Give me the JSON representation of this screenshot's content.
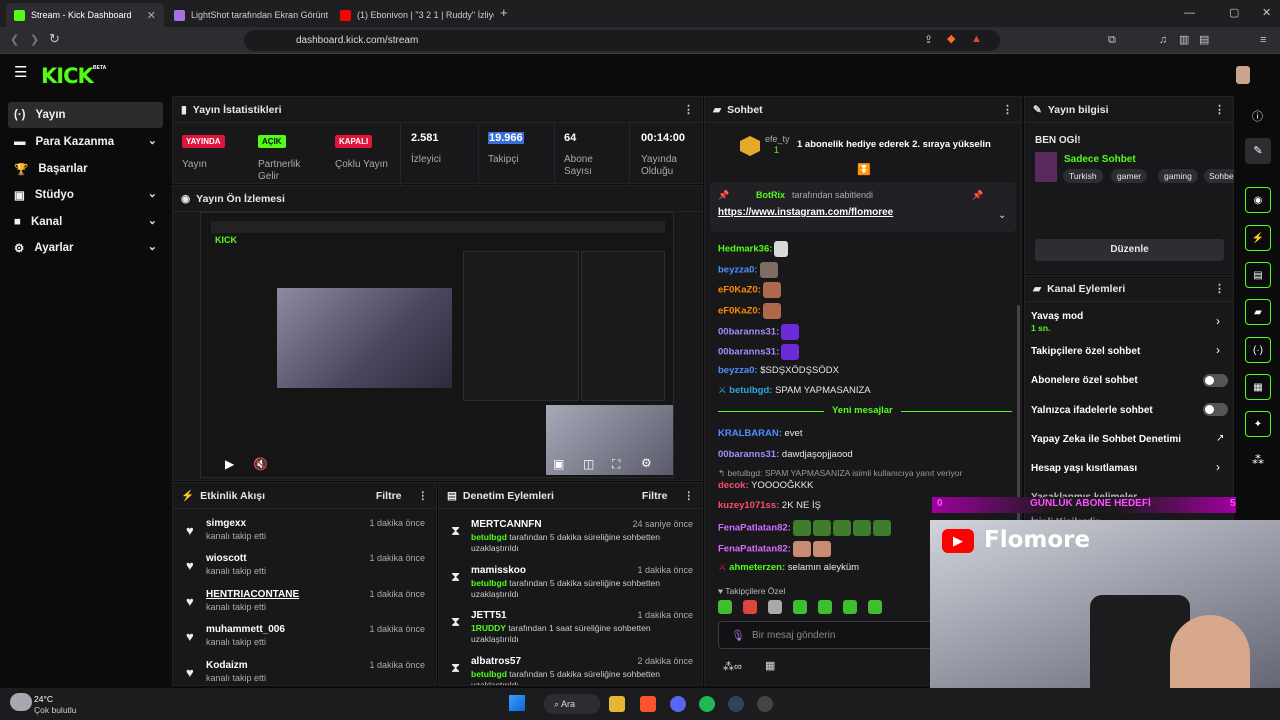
{
  "browser": {
    "tabs": [
      {
        "title": "Stream - Kick Dashboard",
        "color": "#53fc18"
      },
      {
        "title": "LightShot tarafından Ekran Görüntüs",
        "color": "#a772e0"
      },
      {
        "title": "(1) Ebonivon | \"3 2 1 | Ruddy\" İzliyor",
        "color": "#ff0000"
      }
    ],
    "url": "dashboard.kick.com/stream"
  },
  "brand": {
    "logo": "KICK",
    "beta": "BETA"
  },
  "sidebar": {
    "items": [
      {
        "label": "Yayın",
        "icon": "(·)"
      },
      {
        "label": "Para Kazanma",
        "icon": "▬"
      },
      {
        "label": "Başarılar",
        "icon": "🏆"
      },
      {
        "label": "Stüdyo",
        "icon": "▣"
      },
      {
        "label": "Kanal",
        "icon": "■"
      },
      {
        "label": "Ayarlar",
        "icon": "⚙"
      }
    ]
  },
  "stats": {
    "title": "Yayın İstatistikleri",
    "items": [
      {
        "badge": "YAYINDA",
        "label": "Yayın"
      },
      {
        "badge": "AÇIK",
        "label": "Partnerlik Gelir"
      },
      {
        "badge": "KAPALI",
        "label": "Çoklu Yayın"
      },
      {
        "value": "2.581",
        "label": "İzleyici"
      },
      {
        "value": "19.966",
        "label": "Takipçi"
      },
      {
        "value": "64",
        "label": "Abone Sayısı"
      },
      {
        "value": "00:14:00",
        "label": "Yayında Olduğu"
      }
    ]
  },
  "preview": {
    "title": "Yayın Ön İzlemesi"
  },
  "activity": {
    "title": "Etkinlik Akışı",
    "filter": "Filtre",
    "items": [
      {
        "name": "simgexx",
        "sub": "kanalı takip etti",
        "time": "1 dakika önce"
      },
      {
        "name": "wioscott",
        "sub": "kanalı takip etti",
        "time": "1 dakika önce"
      },
      {
        "name": "HENTRIACONTANE",
        "sub": "kanalı takip etti",
        "time": "1 dakika önce"
      },
      {
        "name": "muhammett_006",
        "sub": "kanalı takip etti",
        "time": "1 dakika önce"
      },
      {
        "name": "Kodaizm",
        "sub": "kanalı takip etti",
        "time": "1 dakika önce"
      }
    ]
  },
  "moderation": {
    "title": "Denetim Eylemleri",
    "filter": "Filtre",
    "items": [
      {
        "name": "MERTCANNFN",
        "by": "betulbgd",
        "desc": " tarafından 5 dakika süreliğine sohbetten uzaklaştırıldı",
        "time": "24 saniye önce"
      },
      {
        "name": "mamisskoo",
        "by": "betulbgd",
        "desc": " tarafından 5 dakika süreliğine sohbetten uzaklaştırıldı",
        "time": "1 dakika önce"
      },
      {
        "name": "JETT51",
        "by": "1RUDDY",
        "desc": " tarafından 1 saat süreliğine sohbetten uzaklaştırıldı",
        "time": "1 dakika önce"
      },
      {
        "name": "albatros57",
        "by": "betulbgd",
        "desc": " tarafından 5 dakika süreliğine sohbetten uzaklaştırıldı",
        "time": "2 dakika önce"
      }
    ]
  },
  "chat": {
    "title": "Sohbet",
    "gift_user": "efe_ty",
    "gift_count": "1",
    "gift_text": "1 abonelik hediye ederek 2. sıraya yükselin",
    "pinned_by": "BotRix",
    "pinned_suffix": "tarafından sabitlendi",
    "pinned_link": "https://www.instagram.com/flomoree",
    "messages": [
      {
        "user": "Hedmark36:",
        "color": "#53fc18",
        "text": "",
        "emotes": 1
      },
      {
        "user": "beyzza0:",
        "color": "#4f8fff",
        "text": "",
        "emotes": 1
      },
      {
        "user": "eF0KaZ0:",
        "color": "#ff8a00",
        "text": "",
        "emotes": 1
      },
      {
        "user": "eF0KaZ0:",
        "color": "#ff8a00",
        "text": "",
        "emotes": 1
      },
      {
        "user": "00baranns31:",
        "color": "#a78bff",
        "text": "",
        "emotes": 1
      },
      {
        "user": "00baranns31:",
        "color": "#a78bff",
        "text": "",
        "emotes": 1
      },
      {
        "user": "beyzza0:",
        "color": "#4f8fff",
        "text": "$SDŞXÖDŞSÖDX",
        "emotes": 0
      },
      {
        "user": "betulbgd:",
        "color": "#2aa9e0",
        "text": "SPAM YAPMASANIZA",
        "emotes": 0
      }
    ],
    "new_label": "Yeni mesajlar",
    "new_messages": [
      {
        "user": "KRALBARAN:",
        "color": "#4f8fff",
        "text": "evet"
      },
      {
        "user": "00baranns31:",
        "color": "#a78bff",
        "text": "dawdjaşopjjaood"
      },
      {
        "user": "",
        "color": "#999",
        "text": "betulbgd: SPAM YAPMASANIZA isimli kullanıcıya yanıt veriyor"
      },
      {
        "user": "decok:",
        "color": "#ff4d6d",
        "text": "YOOOOĞKKK"
      },
      {
        "user": "kuzey1071ss:",
        "color": "#ff4d6d",
        "text": "2K NE İŞ"
      },
      {
        "user": "FenaPatlatan82:",
        "color": "#d66bff",
        "text": ""
      },
      {
        "user": "FenaPatlatan82:",
        "color": "#d66bff",
        "text": ""
      },
      {
        "user": "ahmeterzen:",
        "color": "#53fc18",
        "text": "selamın aleyküm"
      }
    ],
    "followers_only": "Takipçilere Özel",
    "placeholder": "Bir mesaj gönderin"
  },
  "info": {
    "title": "Yayın bilgisi",
    "stream_title": "BEN OGİ!",
    "category": "Sadece Sohbet",
    "tags": [
      "Turkish",
      "gamer",
      "gaming",
      "Sohbet"
    ],
    "edit": "Düzenle"
  },
  "channel_actions": {
    "title": "Kanal Eylemleri",
    "slow_mode": "Yavaş mod",
    "slow_value": "1 sn.",
    "items": [
      "Takipçilere özel sohbet",
      "Abonelere özel sohbet",
      "Yalnızca ifadelerle sohbet",
      "Yapay Zeka ile Sohbet Denetimi",
      "Hesap yaşı kısıtlaması",
      "Yasaklanmış kelimeler",
      "İzinli Kişilerdir"
    ]
  },
  "overlay": {
    "brand": "Flomore",
    "goal": "GÜNLÜK ABONE HEDEFİ",
    "goal_left": "0",
    "goal_right": "5"
  },
  "taskbar": {
    "temp": "24°C",
    "weather": "Çok bulutlu",
    "search": "Ara"
  }
}
